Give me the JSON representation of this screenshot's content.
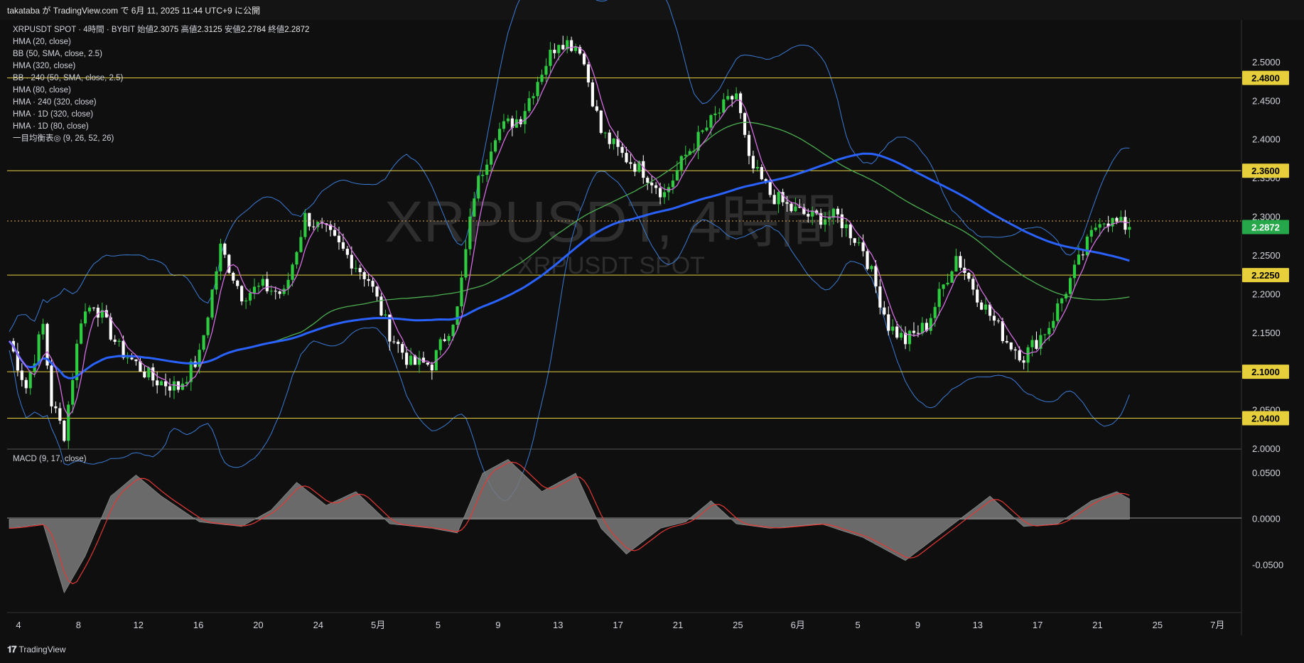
{
  "header": {
    "publish_line": "takataba が TradingView.com で 6月 11, 2025 11:44 UTC+9 に公開"
  },
  "legend": {
    "symbol_line": "XRPUSDT SPOT · 4時間 · BYBIT",
    "open_label": "始値",
    "open": "2.3075",
    "high_label": "高値",
    "high": "2.3125",
    "low_label": "安値",
    "low": "2.2784",
    "close_label": "終値",
    "close": "2.2872",
    "indicators": [
      "HMA (20, close)",
      "BB (50, SMA, close, 2.5)",
      "HMA (320, close)",
      "BB · 240 (50, SMA, close, 2.5)",
      "HMA (80, close)",
      "HMA · 240 (320, close)",
      "HMA · 1D (320, close)",
      "HMA · 1D (80, close)",
      "一目均衡表◎ (9, 26, 52, 26)"
    ]
  },
  "watermark": {
    "main": "XRPUSDT, 4時間",
    "sub": "XRPUSDT SPOT"
  },
  "macd_label": "MACD (9, 17, close)",
  "footer": {
    "brand": "TradingView"
  },
  "colors": {
    "background": "#0f0f0f",
    "candle_up": "#2ecc40",
    "candle_down": "#ffffff",
    "hline": "#e6cf3a",
    "hma_fast": "#d36ee0",
    "bb": "#3a7bd5",
    "hma_slow": "#2962ff",
    "hma_green": "#4caf50",
    "macd_line": "#e53935",
    "macd_hist": "#7a7a7a",
    "price_badge": "#26a84a"
  },
  "chart_data": [
    {
      "type": "candlestick",
      "symbol": "XRPUSDT",
      "timeframe": "4時間",
      "x_ticks": [
        "4",
        "8",
        "12",
        "16",
        "20",
        "24",
        "5月",
        "5",
        "9",
        "13",
        "17",
        "21",
        "25",
        "6月",
        "5",
        "9",
        "13",
        "17",
        "21",
        "25",
        "7月"
      ],
      "y_ticks": [
        "2.5000",
        "2.4500",
        "2.4000",
        "2.3500",
        "2.3000",
        "2.2500",
        "2.2000",
        "2.1500",
        "2.1000",
        "2.0500",
        "2.0000"
      ],
      "ylim": [
        2.0,
        2.555
      ],
      "current_price": "2.2872",
      "horizontal_levels": [
        "2.4800",
        "2.3600",
        "2.2250",
        "2.1000",
        "2.0400"
      ],
      "close_path": [
        [
          0,
          2.14
        ],
        [
          4,
          2.08
        ],
        [
          8,
          2.16
        ],
        [
          10,
          2.06
        ],
        [
          13,
          2.02
        ],
        [
          17,
          2.17
        ],
        [
          20,
          2.19
        ],
        [
          26,
          2.13
        ],
        [
          30,
          2.11
        ],
        [
          34,
          2.09
        ],
        [
          40,
          2.08
        ],
        [
          45,
          2.12
        ],
        [
          50,
          2.26
        ],
        [
          55,
          2.2
        ],
        [
          60,
          2.21
        ],
        [
          65,
          2.2
        ],
        [
          70,
          2.3
        ],
        [
          75,
          2.28
        ],
        [
          80,
          2.25
        ],
        [
          85,
          2.22
        ],
        [
          90,
          2.15
        ],
        [
          95,
          2.11
        ],
        [
          100,
          2.11
        ],
        [
          106,
          2.18
        ],
        [
          110,
          2.33
        ],
        [
          115,
          2.41
        ],
        [
          121,
          2.43
        ],
        [
          126,
          2.49
        ],
        [
          130,
          2.53
        ],
        [
          135,
          2.52
        ],
        [
          140,
          2.41
        ],
        [
          145,
          2.38
        ],
        [
          150,
          2.36
        ],
        [
          155,
          2.33
        ],
        [
          160,
          2.38
        ],
        [
          167,
          2.43
        ],
        [
          172,
          2.46
        ],
        [
          175,
          2.37
        ],
        [
          180,
          2.33
        ],
        [
          185,
          2.31
        ],
        [
          190,
          2.3
        ],
        [
          196,
          2.3
        ],
        [
          202,
          2.26
        ],
        [
          208,
          2.16
        ],
        [
          212,
          2.14
        ],
        [
          217,
          2.16
        ],
        [
          224,
          2.25
        ],
        [
          230,
          2.19
        ],
        [
          236,
          2.14
        ],
        [
          240,
          2.12
        ],
        [
          246,
          2.16
        ],
        [
          252,
          2.23
        ],
        [
          258,
          2.3
        ],
        [
          263,
          2.29
        ],
        [
          265,
          2.2872
        ]
      ]
    },
    {
      "type": "histogram",
      "title": "MACD (9, 17, close)",
      "y_ticks": [
        "0.0500",
        "0.0000",
        "-0.0500"
      ],
      "ylim": [
        -0.1,
        0.07
      ],
      "path": [
        [
          0,
          -0.01
        ],
        [
          8,
          -0.005
        ],
        [
          13,
          -0.08
        ],
        [
          18,
          -0.04
        ],
        [
          24,
          0.025
        ],
        [
          30,
          0.048
        ],
        [
          36,
          0.025
        ],
        [
          45,
          -0.003
        ],
        [
          55,
          -0.008
        ],
        [
          62,
          0.01
        ],
        [
          68,
          0.04
        ],
        [
          75,
          0.015
        ],
        [
          82,
          0.03
        ],
        [
          90,
          -0.005
        ],
        [
          100,
          -0.01
        ],
        [
          106,
          -0.015
        ],
        [
          112,
          0.05
        ],
        [
          118,
          0.065
        ],
        [
          126,
          0.03
        ],
        [
          134,
          0.05
        ],
        [
          140,
          -0.01
        ],
        [
          146,
          -0.038
        ],
        [
          154,
          -0.01
        ],
        [
          160,
          -0.003
        ],
        [
          166,
          0.02
        ],
        [
          172,
          -0.005
        ],
        [
          180,
          -0.01
        ],
        [
          192,
          -0.005
        ],
        [
          202,
          -0.02
        ],
        [
          212,
          -0.045
        ],
        [
          222,
          -0.01
        ],
        [
          232,
          0.025
        ],
        [
          240,
          -0.008
        ],
        [
          248,
          -0.005
        ],
        [
          256,
          0.02
        ],
        [
          262,
          0.03
        ],
        [
          265,
          0.022
        ]
      ]
    }
  ]
}
